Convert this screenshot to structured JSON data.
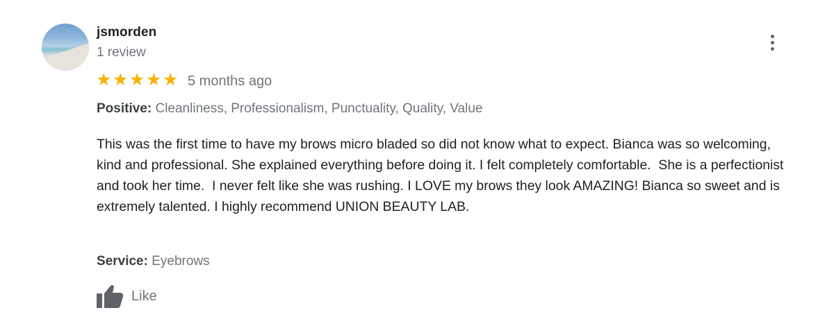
{
  "author": {
    "name": "jsmorden",
    "meta": "1 review"
  },
  "rating": {
    "stars": 5,
    "max": 5,
    "star_glyph": "★",
    "color": "#f4b400"
  },
  "time": "5 months ago",
  "positive": {
    "label": "Positive:",
    "value": " Cleanliness, Professionalism, Punctuality, Quality, Value"
  },
  "review_text": "This was the first time to have my brows micro bladed so did not know what to expect. Bianca was so welcoming, kind and professional. She explained everything before doing it. I felt completely comfortable.  She is a perfectionist and took her time.  I never felt like she was rushing. I LOVE my brows they look AMAZING! Bianca so sweet and is extremely talented. I highly recommend UNION BEAUTY LAB.",
  "service": {
    "label": "Service:",
    "value": " Eyebrows"
  },
  "actions": {
    "like_label": "Like",
    "like_icon": "thumbs-up-icon",
    "more_icon": "more-vert-icon"
  }
}
